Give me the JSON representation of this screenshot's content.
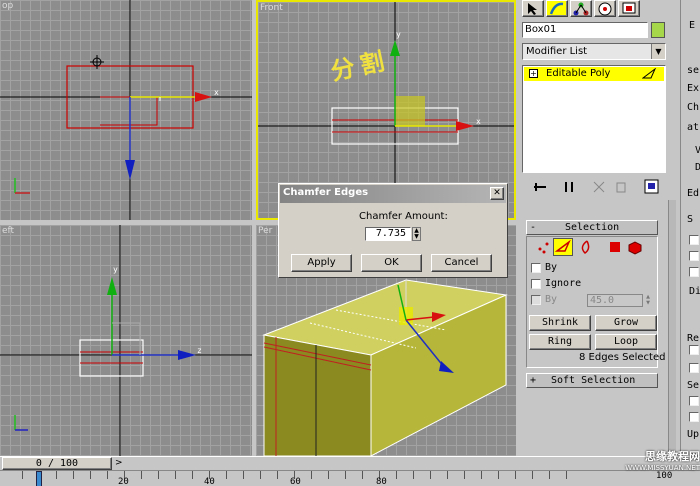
{
  "viewports": {
    "top": {
      "label": "op"
    },
    "front": {
      "label": "Front"
    },
    "left": {
      "label": "eft"
    },
    "perspective": {
      "label": "Per"
    }
  },
  "annotation_text": "分割",
  "axis": {
    "x": "x",
    "y": "y",
    "z": "z"
  },
  "dialog": {
    "title": "Chamfer Edges",
    "close": "✕",
    "amount_label": "Chamfer Amount:",
    "amount_value": "7.735",
    "apply": "Apply",
    "ok": "OK",
    "cancel": "Cancel"
  },
  "command_panel": {
    "tabs": [
      "create-icon",
      "modify-icon",
      "hierarchy-icon",
      "motion-icon",
      "display-icon"
    ],
    "object_name": "Box01",
    "object_color": "#a6d64a",
    "modifier_list": "Modifier List",
    "stack_item": "Editable Poly",
    "selection": {
      "title": "Selection",
      "by_vertex": "By",
      "ignore": "Ignore",
      "by_angle": "By",
      "angle_value": "45.0",
      "shrink": "Shrink",
      "grow": "Grow",
      "ring": "Ring",
      "loop": "Loop",
      "status": "8 Edges Selected"
    },
    "soft_selection": "Soft Selection",
    "minus": "-",
    "plus": "+"
  },
  "side_panel": {
    "letters": [
      "E",
      "se",
      "Ex",
      "Ch",
      "at",
      "V",
      "D",
      "Ed",
      "S",
      "Di",
      "Re",
      "Se",
      "Up"
    ]
  },
  "timeline": {
    "frame": "0 / 100",
    "ticks": [
      "20",
      "40",
      "60",
      "80",
      "100"
    ]
  },
  "watermark": {
    "cn": "思缘教程网",
    "url": "WWW.MISSYUAN.NET"
  },
  "colors": {
    "selected_tab": "#ffff00",
    "accent_yellow": "#f2f23c",
    "edge_red": "#d21a1a",
    "x_axis": "#e01010",
    "y_axis": "#10c010",
    "z_axis": "#1010d0",
    "box_fill": "#bdbe3c"
  }
}
